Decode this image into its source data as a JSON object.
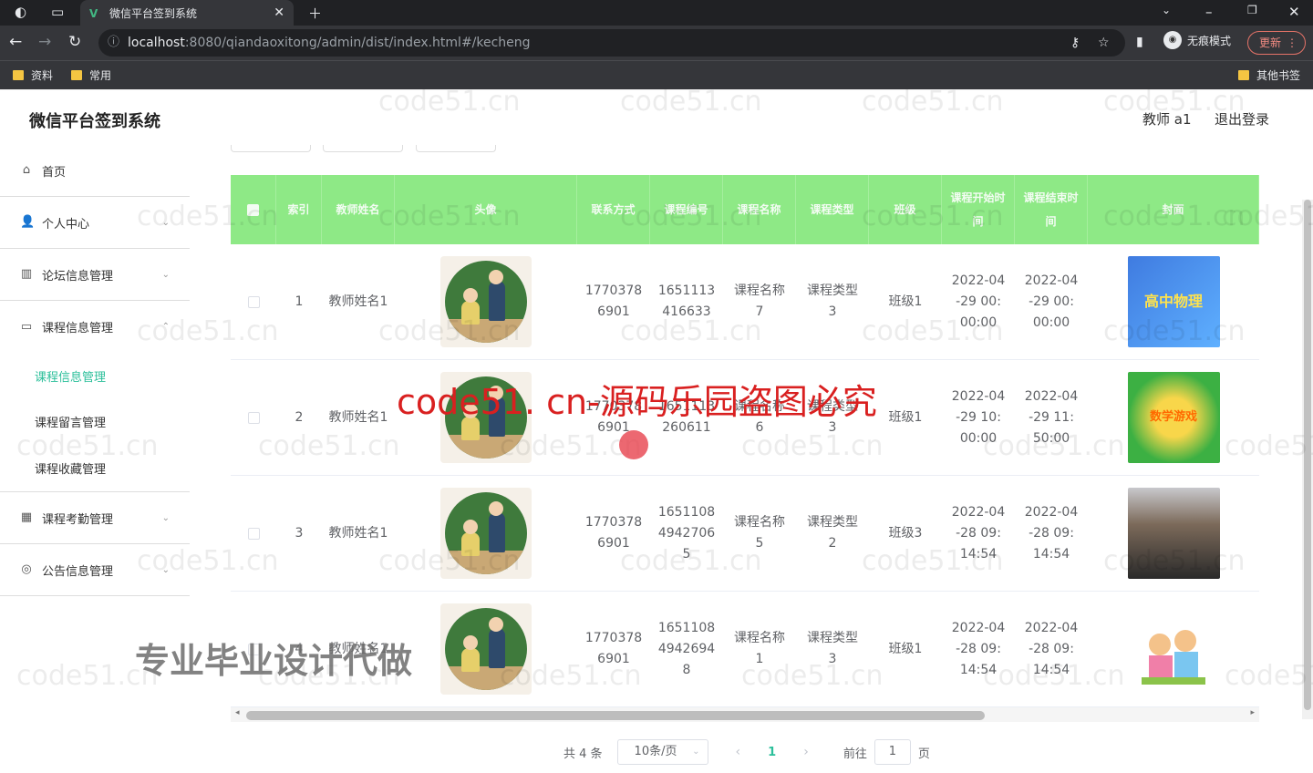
{
  "browser": {
    "tab_title": "微信平台签到系统",
    "url_host": "localhost",
    "url_rest": ":8080/qiandaoxitong/admin/dist/index.html#/kecheng",
    "incognito_label": "无痕模式",
    "update_label": "更新",
    "bookmarks": [
      "资料",
      "常用"
    ],
    "other_bookmarks": "其他书签"
  },
  "app": {
    "title": "微信平台签到系统",
    "user": "教师 a1",
    "logout": "退出登录"
  },
  "sidebar": {
    "items": [
      {
        "label": "首页",
        "icon": "home-icon",
        "glyph": "⌂"
      },
      {
        "label": "个人中心",
        "icon": "user-icon",
        "glyph": "👤",
        "chevron": true
      },
      {
        "label": "论坛信息管理",
        "icon": "chart-icon",
        "glyph": "▥",
        "chevron": true
      },
      {
        "label": "课程信息管理",
        "icon": "folder-icon",
        "glyph": "▭",
        "chevron": true
      }
    ],
    "sub_items": [
      "课程信息管理",
      "课程留言管理",
      "课程收藏管理"
    ],
    "items_after": [
      {
        "label": "课程考勤管理",
        "icon": "grid-icon",
        "glyph": "▦",
        "chevron": true
      },
      {
        "label": "公告信息管理",
        "icon": "globe-icon",
        "glyph": "◎",
        "chevron": true
      }
    ]
  },
  "table": {
    "headers": [
      "",
      "索引",
      "教师姓名",
      "头像",
      "联系方式",
      "课程编号",
      "课程名称",
      "课程类型",
      "班级",
      "课程开始时间",
      "课程结束时间",
      "封面"
    ],
    "rows": [
      {
        "index": "1",
        "teacher": "教师姓名1",
        "phone": "17703786901",
        "code": "1651113416633",
        "course": "课程名称7",
        "type": "课程类型3",
        "class": "班级1",
        "start": "2022-04-29 00:00:00",
        "end": "2022-04-29 00:00:00",
        "cover": "高中物理"
      },
      {
        "index": "2",
        "teacher": "教师姓名1",
        "phone": "17703786901",
        "code": "1651113260611",
        "course": "课程名称6",
        "type": "课程类型3",
        "class": "班级1",
        "start": "2022-04-29 10:00:00",
        "end": "2022-04-29 11:50:00",
        "cover": "数学游戏"
      },
      {
        "index": "3",
        "teacher": "教师姓名1",
        "phone": "17703786901",
        "code": "165110849427065",
        "course": "课程名称5",
        "type": "课程类型2",
        "class": "班级3",
        "start": "2022-04-28 09:14:54",
        "end": "2022-04-28 09:14:54",
        "cover": ""
      },
      {
        "index": "4",
        "teacher": "教师姓名1",
        "phone": "17703786901",
        "code": "165110849426948",
        "course": "课程名称1",
        "type": "课程类型3",
        "class": "班级1",
        "start": "2022-04-28 09:14:54",
        "end": "2022-04-28 09:14:54",
        "cover": ""
      }
    ]
  },
  "pagination": {
    "total": "共 4 条",
    "page_size": "10条/页",
    "current": "1",
    "goto_label": "前往",
    "goto_value": "1",
    "page_suffix": "页"
  },
  "overlays": {
    "watermark": "code51.cn",
    "red_text": "code51. cn-源码乐园盗图必究",
    "gray_text": "专业毕业设计代做"
  }
}
